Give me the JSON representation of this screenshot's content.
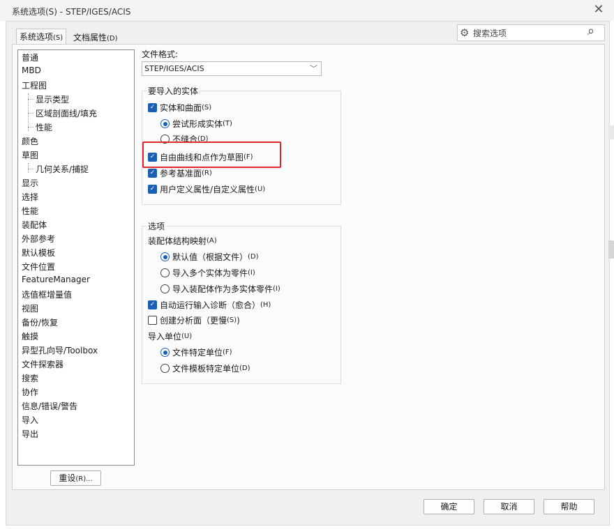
{
  "window": {
    "title": "系统选项(S) - STEP/IGES/ACIS",
    "close_glyph": "✕"
  },
  "tabs": [
    {
      "label": "系统选项",
      "hotkey": "(S)"
    },
    {
      "label": "文档属性",
      "hotkey": "(D)"
    }
  ],
  "search": {
    "placeholder": "搜索选项"
  },
  "tree": {
    "items": [
      {
        "label": "普通",
        "level": 0
      },
      {
        "label": "MBD",
        "level": 0
      },
      {
        "label": "工程图",
        "level": 0
      },
      {
        "label": "显示类型",
        "level": 1
      },
      {
        "label": "区域剖面线/填充",
        "level": 1
      },
      {
        "label": "性能",
        "level": 1
      },
      {
        "label": "颜色",
        "level": 0
      },
      {
        "label": "草图",
        "level": 0
      },
      {
        "label": "几何关系/捕捉",
        "level": 1
      },
      {
        "label": "显示",
        "level": 0
      },
      {
        "label": "选择",
        "level": 0
      },
      {
        "label": "性能",
        "level": 0
      },
      {
        "label": "装配体",
        "level": 0
      },
      {
        "label": "外部参考",
        "level": 0
      },
      {
        "label": "默认模板",
        "level": 0
      },
      {
        "label": "文件位置",
        "level": 0
      },
      {
        "label": "FeatureManager",
        "level": 0
      },
      {
        "label": "选值框增量值",
        "level": 0
      },
      {
        "label": "视图",
        "level": 0
      },
      {
        "label": "备份/恢复",
        "level": 0
      },
      {
        "label": "触摸",
        "level": 0
      },
      {
        "label": "异型孔向导/Toolbox",
        "level": 0
      },
      {
        "label": "文件探索器",
        "level": 0
      },
      {
        "label": "搜索",
        "level": 0
      },
      {
        "label": "协作",
        "level": 0
      },
      {
        "label": "信息/错误/警告",
        "level": 0
      },
      {
        "label": "导入",
        "level": 0
      },
      {
        "label": "导出",
        "level": 0
      }
    ]
  },
  "reset_button": {
    "label": "重设",
    "hotkey": "(R)..."
  },
  "file_format": {
    "label": "文件格式:",
    "value": "STEP/IGES/ACIS"
  },
  "import_entities": {
    "title": "要导入的实体",
    "solids_surfaces": {
      "label": "实体和曲面",
      "hotkey": "(S)",
      "checked": true
    },
    "try_form_solid": {
      "label": "尝试形成实体",
      "hotkey": "(T)",
      "selected": true
    },
    "no_knit": {
      "label": "不缝合",
      "hotkey": "(D)",
      "selected": false
    },
    "free_curves": {
      "label": "自由曲线和点作为草图",
      "hotkey": "(F)",
      "checked": true
    },
    "ref_planes": {
      "label": "参考基准面",
      "hotkey": "(R)",
      "checked": true
    },
    "user_props": {
      "label": "用户定义属性/自定义属性",
      "hotkey": "(U)",
      "checked": true
    }
  },
  "options": {
    "title": "选项",
    "asm_mapping": {
      "label": "装配体结构映射",
      "hotkey": "(A)"
    },
    "default_from_file": {
      "label": "默认值（根据文件）",
      "hotkey": "(D)",
      "selected": true
    },
    "import_multi_as_parts": {
      "label": "导入多个实体为零件",
      "hotkey": "(I)",
      "selected": false
    },
    "import_asm_as_multibody": {
      "label": "导入装配体作为多实体零件",
      "hotkey": "(I)",
      "selected": false
    },
    "auto_diagnostics": {
      "label": "自动运行输入诊断（愈合）",
      "hotkey": "(H)",
      "checked": true
    },
    "create_analysis": {
      "label": "创建分析面（更慢",
      "hotkey": "(S)",
      "after": ")",
      "checked": false
    },
    "import_units": {
      "label": "导入单位",
      "hotkey": "(U)"
    },
    "file_units": {
      "label": "文件特定单位",
      "hotkey": "(F)",
      "selected": true
    },
    "template_units": {
      "label": "文件模板特定单位",
      "hotkey": "(D)",
      "selected": false
    }
  },
  "footer": {
    "ok": "确定",
    "cancel": "取消",
    "help": "帮助"
  },
  "colors": {
    "accent": "#1a5fb4",
    "highlight": "#e0252b"
  }
}
